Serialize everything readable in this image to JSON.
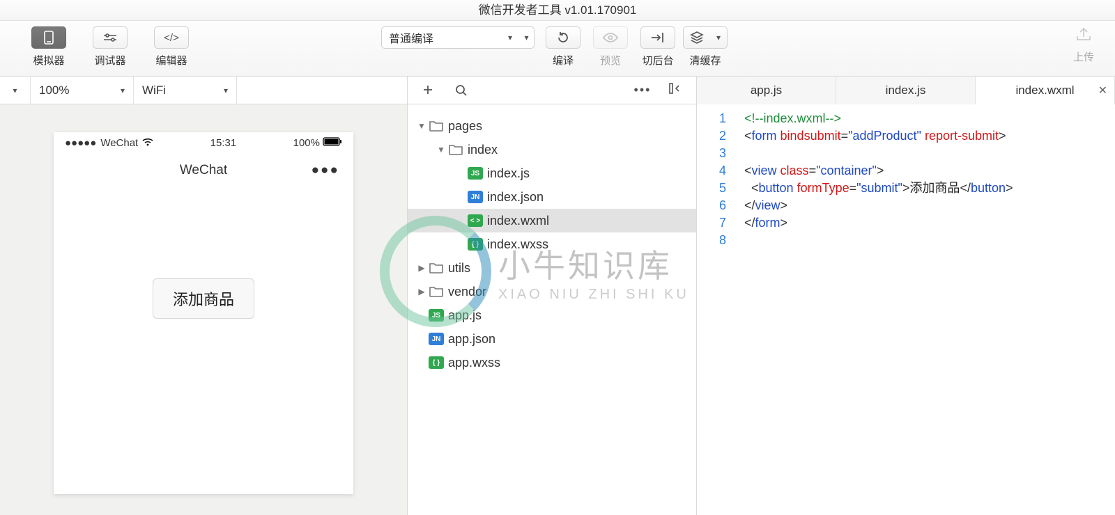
{
  "window": {
    "title": "微信开发者工具 v1.01.170901"
  },
  "toolbar": {
    "simulator": "模拟器",
    "debugger": "调试器",
    "editor": "编辑器",
    "compile_mode": "普通编译",
    "compile": "编译",
    "preview": "预览",
    "background": "切后台",
    "clear_cache": "清缓存",
    "upload": "上传"
  },
  "subbar": {
    "zoom": "100%",
    "network": "WiFi"
  },
  "simulator": {
    "carrier": "WeChat",
    "time": "15:31",
    "battery": "100%",
    "nav_title": "WeChat",
    "button_label": "添加商品"
  },
  "tree": {
    "items": [
      {
        "depth": 0,
        "type": "folder-open",
        "caret": "down",
        "label": "pages"
      },
      {
        "depth": 1,
        "type": "folder-open",
        "caret": "down",
        "label": "index"
      },
      {
        "depth": 2,
        "type": "js",
        "label": "index.js"
      },
      {
        "depth": 2,
        "type": "jn",
        "label": "index.json"
      },
      {
        "depth": 2,
        "type": "xm",
        "label": "index.wxml",
        "selected": true
      },
      {
        "depth": 2,
        "type": "xs",
        "label": "index.wxss"
      },
      {
        "depth": 0,
        "type": "folder-closed",
        "caret": "right",
        "label": "utils"
      },
      {
        "depth": 0,
        "type": "folder-closed",
        "caret": "right",
        "label": "vendor"
      },
      {
        "depth": 0,
        "type": "js",
        "label": "app.js"
      },
      {
        "depth": 0,
        "type": "jn",
        "label": "app.json"
      },
      {
        "depth": 0,
        "type": "xs",
        "label": "app.wxss"
      }
    ]
  },
  "tabs": [
    {
      "label": "app.js"
    },
    {
      "label": "index.js"
    },
    {
      "label": "index.wxml",
      "active": true,
      "closable": true
    }
  ],
  "code": {
    "lines": [
      {
        "n": 1,
        "html": "<span class='c-com'>&lt;!--index.wxml--&gt;</span>"
      },
      {
        "n": 2,
        "html": "&lt;<span class='c-tag'>form</span> <span class='c-attr'>bindsubmit</span>=<span class='c-str'>\"addProduct\"</span> <span class='c-attr'>report-submit</span>&gt;"
      },
      {
        "n": 3,
        "html": ""
      },
      {
        "n": 4,
        "html": "&lt;<span class='c-tag'>view</span> <span class='c-attr'>class</span>=<span class='c-str'>\"container\"</span>&gt;"
      },
      {
        "n": 5,
        "html": "  &lt;<span class='c-tag'>button</span> <span class='c-attr'>formType</span>=<span class='c-str'>\"submit\"</span>&gt;<span class='c-txt'>添加商品</span>&lt;/<span class='c-tag'>button</span>&gt;"
      },
      {
        "n": 6,
        "html": "&lt;/<span class='c-tag'>view</span>&gt;"
      },
      {
        "n": 7,
        "html": "&lt;/<span class='c-tag'>form</span>&gt;"
      },
      {
        "n": 8,
        "html": ""
      }
    ]
  },
  "watermark": {
    "zh": "小牛知识库",
    "en": "XIAO NIU ZHI SHI KU"
  }
}
